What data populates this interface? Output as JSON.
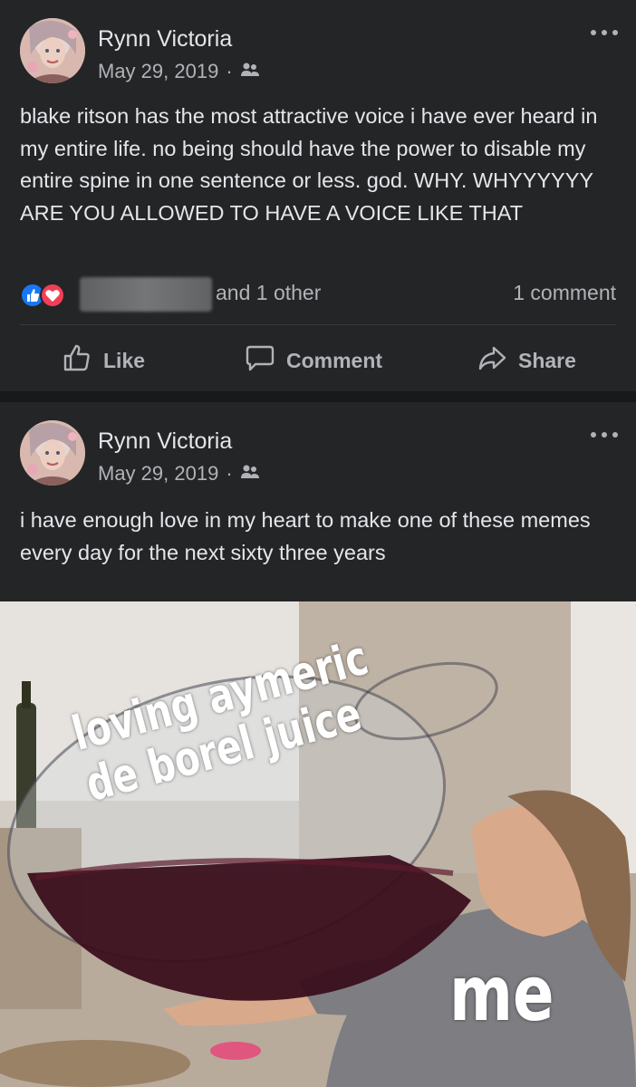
{
  "posts": [
    {
      "author": "Rynn Victoria",
      "date": "May 29, 2019",
      "audience_icon": "friends-icon",
      "text": "blake ritson has the most attractive voice i have ever heard in my entire life. no being should have the power to disable my entire spine in one sentence or less. god. WHY. WHYYYYYY ARE YOU ALLOWED TO HAVE A VOICE LIKE THAT",
      "reactions": {
        "icons": [
          "like-reaction-icon",
          "love-reaction-icon"
        ],
        "text": "and 1 other",
        "comments": "1 comment"
      },
      "actions": {
        "like": "Like",
        "comment": "Comment",
        "share": "Share"
      }
    },
    {
      "author": "Rynn Victoria",
      "date": "May 29, 2019",
      "audience_icon": "friends-icon",
      "text": "i have enough love in my heart to make one of these memes every day for the next sixty three years",
      "meme": {
        "caption_main": "loving aymeric de borel juice",
        "caption_me": "me"
      }
    }
  ],
  "colors": {
    "background": "#18191a",
    "card": "#242526",
    "primary_text": "#e4e6eb",
    "secondary_text": "#b0b3b8",
    "like_blue": "#1877f2",
    "love_red": "#f33e58"
  }
}
